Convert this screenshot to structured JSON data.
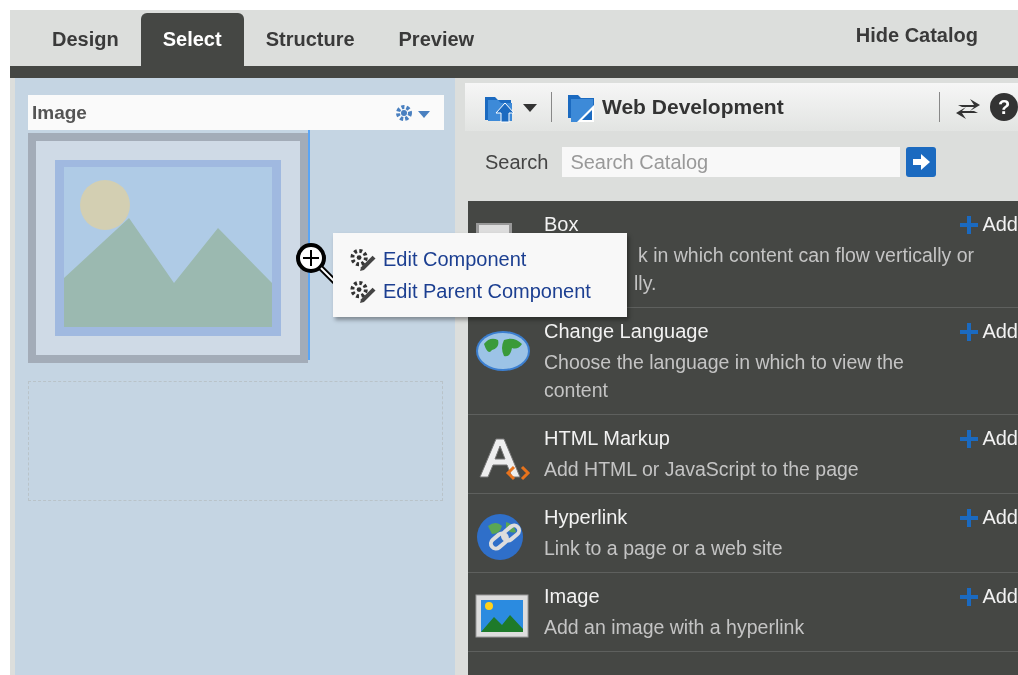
{
  "tabs": [
    {
      "label": "Design",
      "selected": false
    },
    {
      "label": "Select",
      "selected": true
    },
    {
      "label": "Structure",
      "selected": false
    },
    {
      "label": "Preview",
      "selected": false
    }
  ],
  "hide_catalog": "Hide Catalog",
  "canvas": {
    "component_header": {
      "title": "Image"
    },
    "context_menu": {
      "items": [
        "Edit Component",
        "Edit Parent Component"
      ]
    }
  },
  "catalog": {
    "folder": "Web Development",
    "help": "?",
    "search": {
      "label": "Search",
      "placeholder": "Search Catalog"
    },
    "items": [
      {
        "kind": "box",
        "title": "Box",
        "description_lines": [
          "k in which content can flow vertically or",
          "lly."
        ],
        "action": "Add"
      },
      {
        "kind": "language",
        "title": "Change Language",
        "description": "Choose the language in which to view the content",
        "action": "Add"
      },
      {
        "kind": "html",
        "title": "HTML Markup",
        "description": "Add HTML or JavaScript to the page",
        "action": "Add"
      },
      {
        "kind": "hyperlink",
        "title": "Hyperlink",
        "description": "Link to a page or a web site",
        "action": "Add"
      },
      {
        "kind": "image",
        "title": "Image",
        "description": "Add an image with a hyperlink",
        "action": "Add"
      }
    ]
  }
}
